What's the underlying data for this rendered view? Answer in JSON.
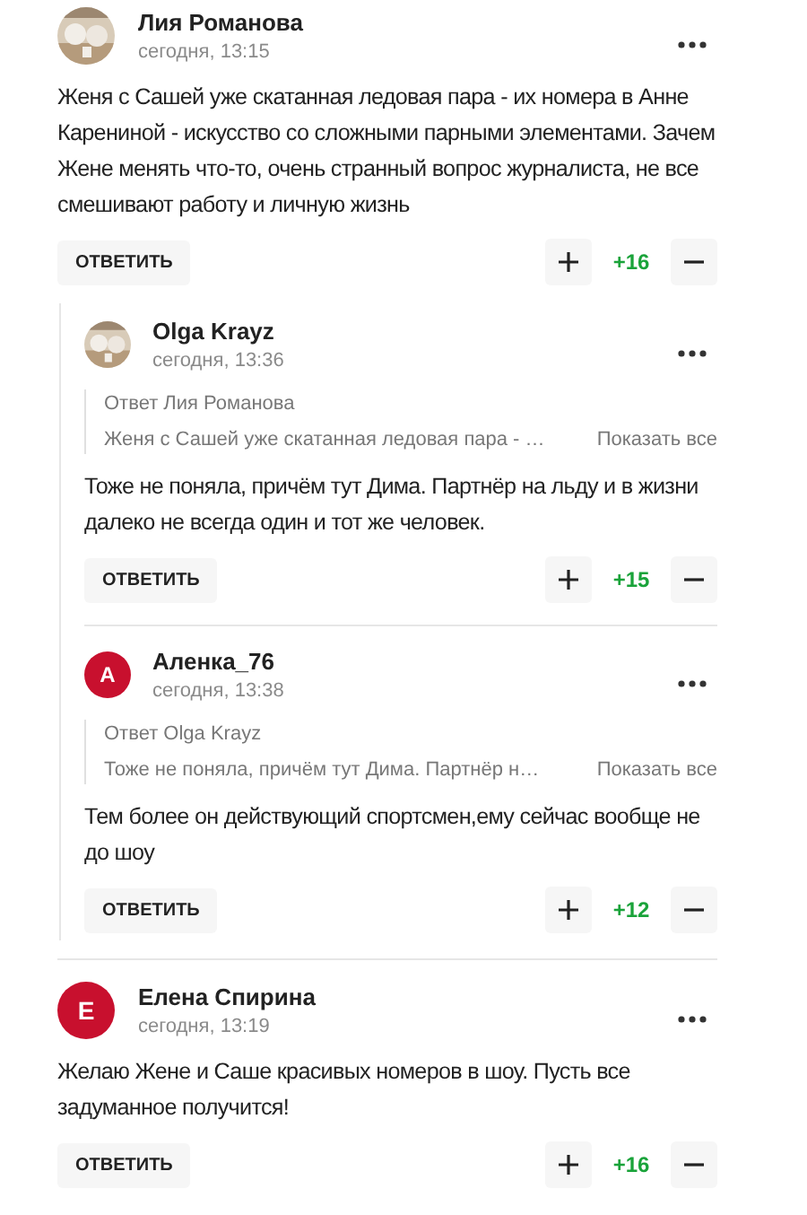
{
  "comments": [
    {
      "author": "Лия Романова",
      "time": "сегодня, 13:15",
      "body": "Женя с Сашей уже скатанная ледовая пара - их номера в Анне Карениной - искусство со сложными парными элементами. Зачем Жене менять что-то, очень странный вопрос журналиста, не все смешивают работу и личную жизнь",
      "reply_button": "ОТВЕТИТЬ",
      "score": "+16",
      "children": [
        {
          "author": "Olga Krayz",
          "time": "сегодня, 13:36",
          "quote": {
            "label": "Ответ Лия Романова",
            "text": "Женя с Сашей уже скатанная ледовая пара - …",
            "link": "Показать все"
          },
          "body": "Тоже не поняла, причём тут Дима. Партнёр на льду и в жизни далеко не всегда один и тот же человек.",
          "reply_button": "ОТВЕТИТЬ",
          "score": "+15"
        },
        {
          "author": "Аленка_76",
          "time": "сегодня, 13:38",
          "avatar": {
            "kind": "letter",
            "letter": "А",
            "color": "#c8102e"
          },
          "quote": {
            "label": "Ответ Olga Krayz",
            "text": "Тоже не поняла, причём тут Дима. Партнёр н…",
            "link": "Показать все"
          },
          "body": "Тем более он действующий спортсмен,ему сейчас вообще не до шоу",
          "reply_button": "ОТВЕТИТЬ",
          "score": "+12"
        }
      ]
    },
    {
      "author": "Елена Спирина",
      "time": "сегодня, 13:19",
      "avatar": {
        "kind": "letter",
        "letter": "Е",
        "color": "#c8102e"
      },
      "body": "Желаю Жене и Саше красивых номеров в шоу. Пусть все задуманное получится!",
      "reply_button": "ОТВЕТИТЬ",
      "score": "+16"
    }
  ]
}
